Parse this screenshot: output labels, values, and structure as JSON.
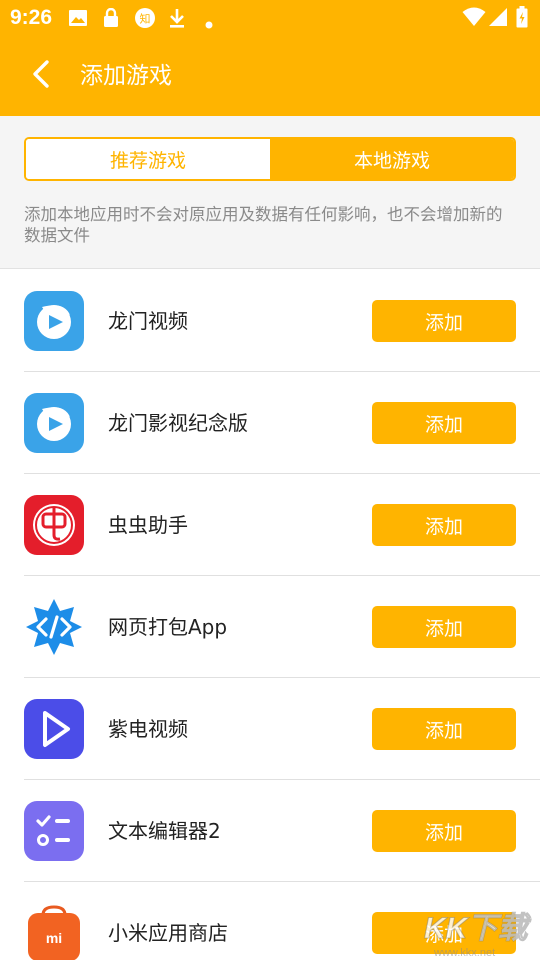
{
  "status_bar": {
    "time": "9:26",
    "icons": [
      "image-icon",
      "lock-icon",
      "zhihu-icon",
      "download-icon",
      "dot-icon",
      "wifi-icon",
      "signal-icon",
      "battery-icon"
    ]
  },
  "app_bar": {
    "title": "添加游戏",
    "back_icon": "back-arrow-icon"
  },
  "tabs": [
    {
      "label": "推荐游戏",
      "active": false
    },
    {
      "label": "本地游戏",
      "active": true
    }
  ],
  "note": "添加本地应用时不会对原应用及数据有任何影响，也不会增加新的数据文件",
  "apps": [
    {
      "name": "龙门视频",
      "button": "添加",
      "icon": "longmen-video-icon"
    },
    {
      "name": "龙门影视纪念版",
      "button": "添加",
      "icon": "longmen-memorial-icon"
    },
    {
      "name": "虫虫助手",
      "button": "添加",
      "icon": "chongchong-icon"
    },
    {
      "name": "网页打包App",
      "button": "添加",
      "icon": "web-pack-icon"
    },
    {
      "name": "紫电视频",
      "button": "添加",
      "icon": "zidian-video-icon"
    },
    {
      "name": "文本编辑器2",
      "button": "添加",
      "icon": "text-editor-icon"
    },
    {
      "name": "小米应用商店",
      "button": "添加",
      "icon": "mi-store-icon"
    }
  ],
  "watermark": {
    "text": "KK下载",
    "url_text": "www.kkx.net"
  },
  "colors": {
    "accent": "#FFB400",
    "note_text": "#8a8a8a",
    "divider": "#e0e0e0"
  }
}
